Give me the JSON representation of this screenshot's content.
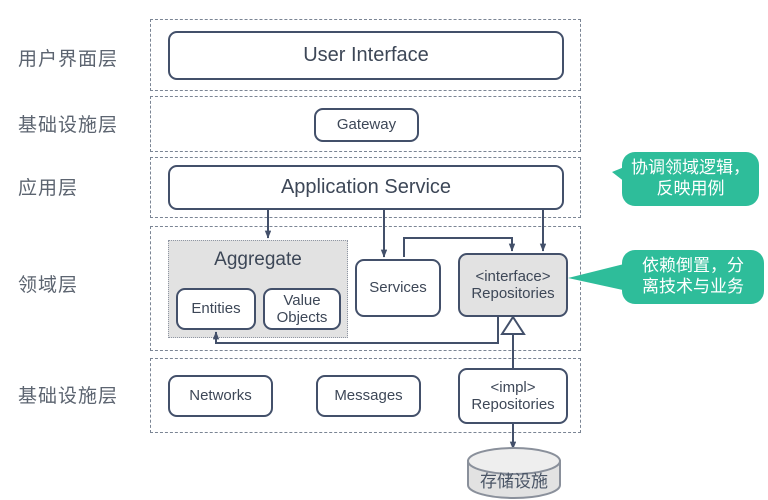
{
  "colors": {
    "stroke": "#43506a",
    "dashed_border": "#7b8594",
    "node_fill": "#ffffff",
    "node_fill_gray": "#e2e2e2",
    "text": "#3d4757",
    "label_text": "#5c6470",
    "callout_green": "#2ebd9a",
    "callout_text": "#ffffff",
    "db_fill": "#e2e2e2"
  },
  "layer_labels": [
    {
      "text": "用户界面层"
    },
    {
      "text": "基础设施层"
    },
    {
      "text": "应用层"
    },
    {
      "text": "领域层"
    },
    {
      "text": "基础设施层"
    }
  ],
  "nodes": {
    "user_interface": "User Interface",
    "gateway": "Gateway",
    "application_service": "Application Service",
    "aggregate": "Aggregate",
    "entities": "Entities",
    "value_objects": "Value\nObjects",
    "services": "Services",
    "interface_repositories": "<interface>\nRepositories",
    "networks": "Networks",
    "messages": "Messages",
    "impl_repositories": "<impl>\nRepositories",
    "storage": "存储设施"
  },
  "callouts": [
    {
      "text": "协调领域逻辑，\n反映用例"
    },
    {
      "text": "依赖倒置，分\n离技术与业务"
    }
  ]
}
